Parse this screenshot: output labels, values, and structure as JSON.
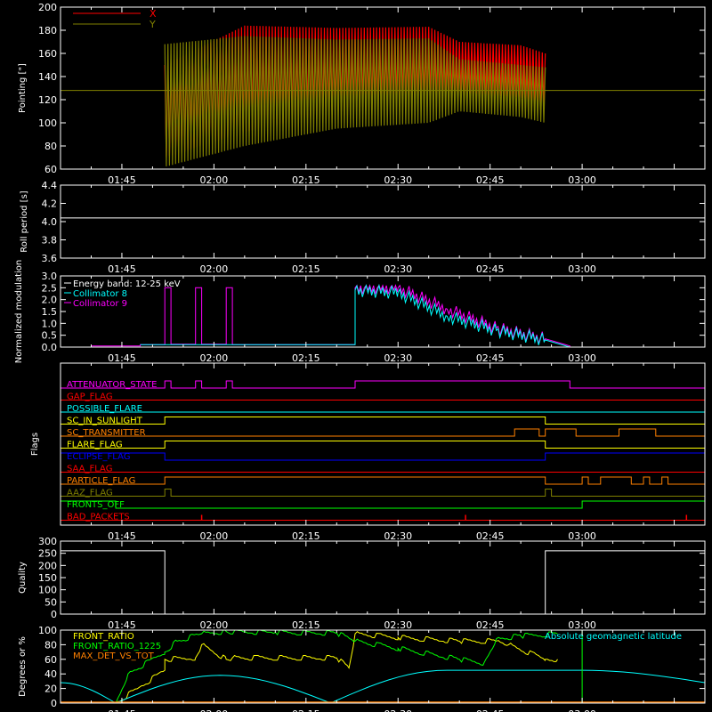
{
  "colors": {
    "background": "#000000",
    "axes": "#ffffff",
    "red": "#ff0000",
    "olive": "#808000",
    "cyan": "#00ffff",
    "magenta": "#ff00ff",
    "yellow": "#ffff00",
    "green": "#00ff00",
    "blue": "#0000ff",
    "orange": "#ff8000",
    "pink": "#ff40a0"
  },
  "time_ticks": [
    "01:45",
    "02:00",
    "02:15",
    "02:30",
    "02:45",
    "03:00"
  ],
  "chart_data": [
    {
      "id": "pointing",
      "type": "line",
      "ylabel": "Pointing [\"]",
      "ylim": [
        60,
        200
      ],
      "yticks": [
        "60",
        "80",
        "100",
        "120",
        "140",
        "160",
        "180",
        "200"
      ],
      "xlim_minutes": [
        95,
        200
      ],
      "legend": [
        {
          "name": "X",
          "color": "#ff0000"
        },
        {
          "name": "Y",
          "color": "#808000"
        }
      ],
      "series": [
        {
          "name": "X",
          "color": "#ff0000",
          "envelope_minutes": [
            112,
            125,
            140,
            155,
            160,
            170,
            174
          ],
          "upper": [
            150,
            184,
            182,
            183,
            170,
            167,
            160
          ],
          "lower": [
            70,
            92,
            110,
            120,
            125,
            122,
            115
          ]
        },
        {
          "name": "Y",
          "color": "#808000",
          "envelope_minutes": [
            112,
            125,
            140,
            155,
            160,
            170,
            174
          ],
          "upper": [
            168,
            175,
            172,
            173,
            155,
            150,
            148
          ],
          "lower": [
            62,
            80,
            95,
            100,
            110,
            105,
            100
          ]
        }
      ],
      "reference_line_y": 128
    },
    {
      "id": "roll_period",
      "type": "line",
      "ylabel": "Roll period [s]",
      "ylim": [
        3.5,
        4.5
      ],
      "yticks": [
        "3.6",
        "3.8",
        "4.0",
        "4.2",
        "4.4"
      ],
      "series": [
        {
          "name": "roll",
          "color": "#ffffff",
          "value": 4.05
        }
      ]
    },
    {
      "id": "modulation",
      "type": "line",
      "ylabel": "Normalized modulation",
      "ylim": [
        0,
        3
      ],
      "yticks": [
        "0.0",
        "0.5",
        "1.0",
        "1.5",
        "2.0",
        "2.5",
        "3.0"
      ],
      "legend": [
        {
          "name": "Energy band: 12-25 keV",
          "color": "#ffffff"
        },
        {
          "name": "Collimator 8",
          "color": "#00ffff"
        },
        {
          "name": "Collimator 9",
          "color": "#ff00ff"
        }
      ],
      "series": [
        {
          "name": "Collimator 9",
          "color": "#ff00ff",
          "x_minutes": [
            100,
            108,
            108,
            112,
            112,
            113,
            113,
            117,
            117,
            118,
            118,
            122,
            122,
            123,
            123,
            143,
            143,
            150,
            158,
            166,
            174,
            178,
            178
          ],
          "y": [
            0.05,
            0.05,
            0.1,
            0.1,
            2.5,
            2.5,
            0.12,
            0.12,
            2.5,
            2.5,
            0.12,
            0.12,
            2.5,
            2.5,
            0.1,
            0.1,
            2.5,
            2.5,
            1.6,
            0.8,
            0.35,
            0.05,
            0.0
          ]
        },
        {
          "name": "Collimator 8",
          "color": "#00ffff",
          "x_minutes": [
            108,
            143,
            143,
            150,
            158,
            166,
            174,
            178
          ],
          "y": [
            0.1,
            0.1,
            2.4,
            2.3,
            1.3,
            0.7,
            0.3,
            0.0
          ]
        }
      ]
    },
    {
      "id": "flags",
      "type": "step",
      "ylabel": "Flags",
      "rows": [
        {
          "label": "ATTENUATOR_STATE",
          "color": "#ff00ff",
          "on_intervals_minutes": [
            [
              112,
              113
            ],
            [
              117,
              118
            ],
            [
              122,
              123
            ],
            [
              143,
              178
            ]
          ]
        },
        {
          "label": "GAP_FLAG",
          "color": "#ff0000",
          "on_intervals_minutes": []
        },
        {
          "label": "POSSIBLE_FLARE",
          "color": "#00ffff",
          "on_intervals_minutes": []
        },
        {
          "label": "SC_IN_SUNLIGHT",
          "color": "#ffff00",
          "on_intervals_minutes": [
            [
              112,
              174
            ]
          ]
        },
        {
          "label": "SC_TRANSMITTER",
          "color": "#ff8000",
          "on_intervals_minutes": [
            [
              169,
              173
            ],
            [
              174,
              179
            ],
            [
              186,
              192
            ]
          ]
        },
        {
          "label": "FLARE_FLAG",
          "color": "#ffff00",
          "on_intervals_minutes": [
            [
              112,
              174
            ]
          ]
        },
        {
          "label": "ECLIPSE_FLAG",
          "color": "#0000ff",
          "on_intervals_minutes": [
            [
              95,
              112
            ],
            [
              174,
              200
            ]
          ]
        },
        {
          "label": "SAA_FLAG",
          "color": "#ff0000",
          "on_intervals_minutes": []
        },
        {
          "label": "PARTICLE_FLAG",
          "color": "#ff8000",
          "on_intervals_minutes": [
            [
              112,
              174
            ],
            [
              180,
              181
            ],
            [
              183,
              188
            ],
            [
              190,
              191
            ],
            [
              193,
              194
            ]
          ]
        },
        {
          "label": "AAZ_FLAG",
          "color": "#808000",
          "on_intervals_minutes": [
            [
              112,
              113
            ],
            [
              174,
              175
            ]
          ]
        },
        {
          "label": "FRONTS_OFF",
          "color": "#00ff00",
          "on_intervals_minutes": [
            [
              95,
              104
            ],
            [
              180,
              200
            ]
          ]
        },
        {
          "label": "BAD_PACKETS",
          "color": "#ff0000",
          "spikes_minutes": [
            118,
            161,
            197
          ]
        }
      ]
    },
    {
      "id": "quality",
      "type": "line",
      "ylabel": "Quality",
      "ylim": [
        0,
        300
      ],
      "yticks": [
        "0",
        "50",
        "100",
        "150",
        "200",
        "250",
        "300"
      ],
      "series": [
        {
          "name": "quality",
          "color": "#ffffff",
          "x_minutes": [
            95,
            112,
            112,
            174,
            174,
            200
          ],
          "y": [
            260,
            260,
            0,
            0,
            260,
            260
          ]
        }
      ]
    },
    {
      "id": "geomagnetic",
      "type": "line",
      "ylabel": "Degrees or %",
      "ylim": [
        0,
        100
      ],
      "yticks": [
        "0",
        "20",
        "40",
        "60",
        "80",
        "100"
      ],
      "legend": [
        {
          "name": "FRONT_RATIO",
          "color": "#ffff00"
        },
        {
          "name": "FRONT_RATIO_1225",
          "color": "#00ff00"
        },
        {
          "name": "MAX_DET_VS_TOT",
          "color": "#ff8000"
        },
        {
          "name": "Absolute geomagnetic latitude",
          "color": "#00ffff"
        }
      ],
      "series": [
        {
          "name": "FRONT_RATIO",
          "color": "#ffff00",
          "x_minutes": [
            104,
            112,
            112,
            117,
            118,
            122,
            123,
            140,
            142,
            143,
            150,
            160,
            166,
            168,
            174,
            176
          ],
          "y": [
            0,
            45,
            60,
            62,
            80,
            60,
            62,
            62,
            48,
            95,
            90,
            85,
            85,
            80,
            60,
            60
          ]
        },
        {
          "name": "FRONT_RATIO_1225",
          "color": "#00ff00",
          "x_minutes": [
            104,
            106,
            112,
            114,
            118,
            122,
            130,
            140,
            143,
            150,
            160,
            164,
            166,
            170,
            176
          ],
          "y": [
            0,
            40,
            70,
            85,
            95,
            98,
            97,
            96,
            85,
            75,
            60,
            55,
            88,
            92,
            95
          ]
        },
        {
          "name": "Absolute geomagnetic latitude",
          "color": "#00ffff",
          "x_minutes": [
            95,
            104,
            121,
            139,
            158,
            180,
            200
          ],
          "y": [
            28,
            0,
            38,
            0,
            45,
            45,
            28
          ]
        },
        {
          "name": "MAX_DET_VS_TOT",
          "color": "#ff8000",
          "value": 0
        }
      ]
    }
  ]
}
